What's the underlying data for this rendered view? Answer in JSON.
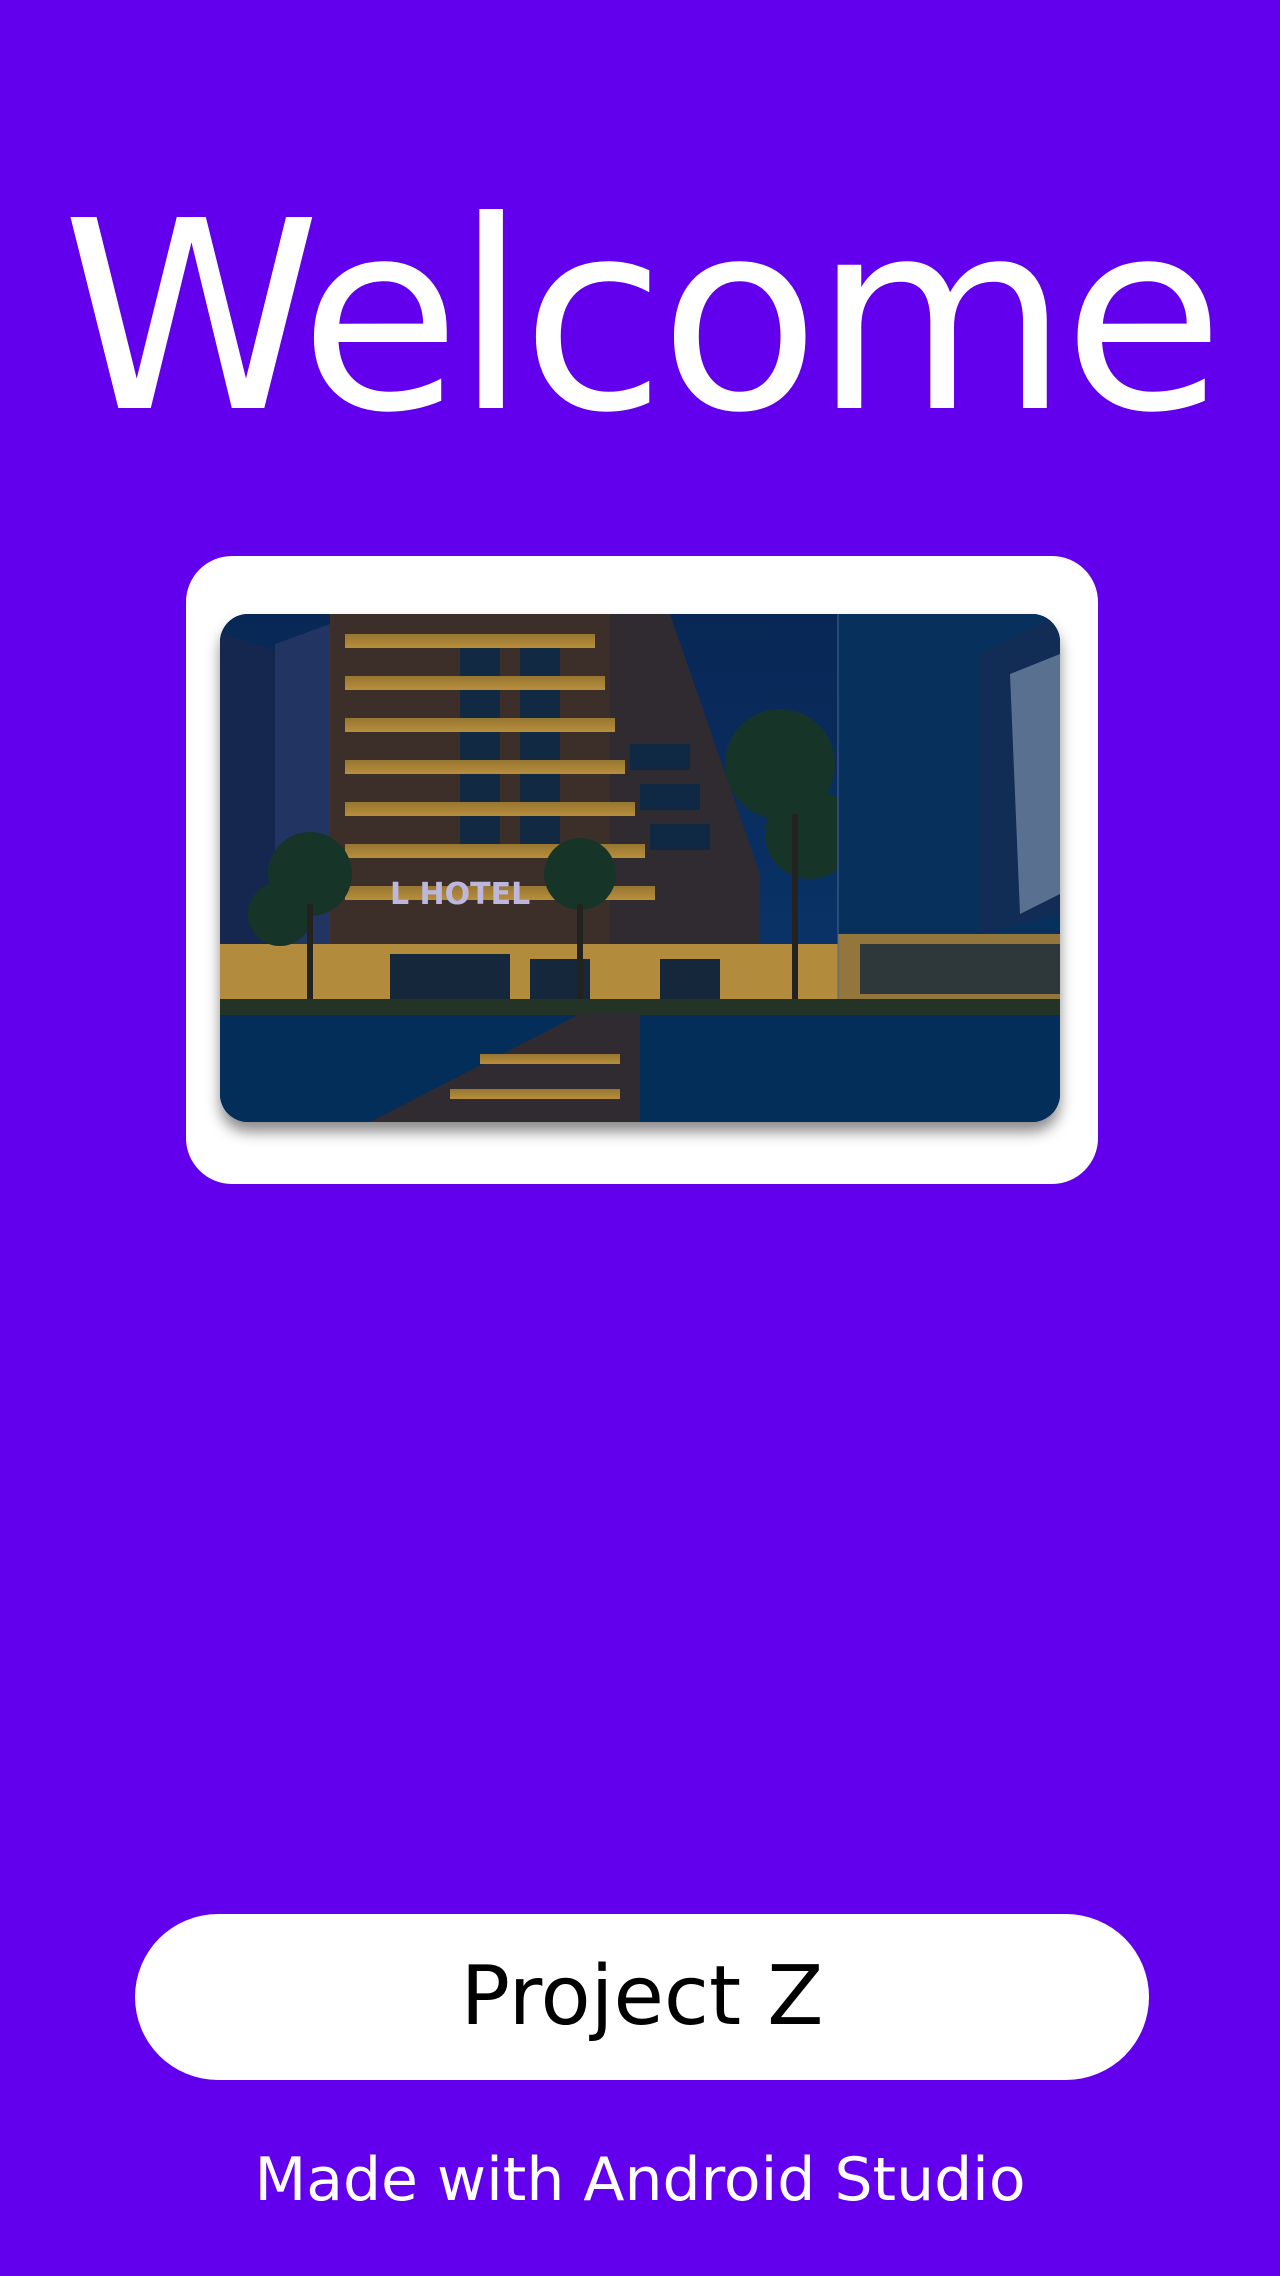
{
  "screen": {
    "background_color": "#6200EE",
    "title": "Welcome"
  },
  "hero_image": {
    "subject": "hotel building at dusk",
    "sign_text": "L HOTEL"
  },
  "primary_button": {
    "label": "Project Z"
  },
  "footer": {
    "text": "Made with Android Studio"
  },
  "colors": {
    "accent": "#6200EE",
    "surface": "#FFFFFF",
    "button_text": "#000000"
  }
}
